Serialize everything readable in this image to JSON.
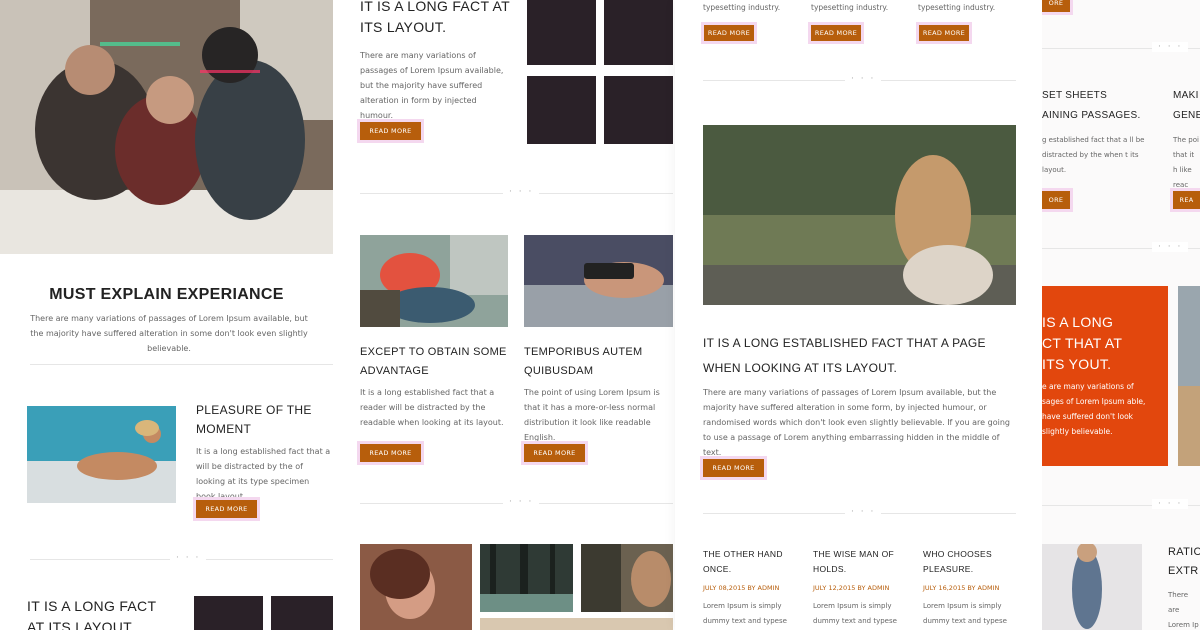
{
  "panel1": {
    "section_title": "MUST EXPLAIN EXPERIANCE",
    "section_text": "There are many variations of passages of Lorem Ipsum available, but the majority have suffered alteration in some don't look even slightly believable.",
    "feature_title": "PLEASURE OF THE MOMENT",
    "feature_text": "It is a long established fact that a will be distracted by the of looking at its type specimen book layout.",
    "feature_btn": "READ MORE",
    "bottom_title": "IT IS A LONG FACT AT ITS LAYOUT.",
    "dots": "· · ·"
  },
  "panel2": {
    "top_title": "IT IS A LONG FACT AT ITS LAYOUT.",
    "top_text": "There are many variations of passages of Lorem Ipsum available, but the majority have suffered alteration in form by injected humour.",
    "top_btn": "READ MORE",
    "dots": "· · ·",
    "card1_title": "EXCEPT TO OBTAIN SOME ADVANTAGE",
    "card1_text": "It is a long established fact that a reader will be distracted by the readable when looking at its layout.",
    "card1_btn": "READ MORE",
    "card2_title": "TEMPORIBUS AUTEM QUIBUSDAM",
    "card2_text": "The point of using Lorem Ipsum is that it has a more-or-less normal distribution it look like readable English.",
    "card2_btn": "READ MORE"
  },
  "panel3": {
    "col1_text": "typesetting industry.",
    "col2_text": "typesetting industry.",
    "col3_text": "typesetting industry.",
    "btn": "READ MORE",
    "dots": "· · ·",
    "main_title": "IT IS A LONG ESTABLISHED FACT THAT A PAGE WHEN LOOKING AT ITS LAYOUT.",
    "main_text": "There are many variations of passages of Lorem Ipsum available, but the majority have suffered alteration in some form, by injected humour, or randomised words which don't look even slightly believable. If you are going to use a passage of Lorem anything embarrassing hidden in the middle of text.",
    "main_btn": "READ MORE",
    "posts": [
      {
        "title": "THE OTHER HAND ONCE.",
        "date": "JULY 08,2015 BY ADMIN",
        "text": "Lorem Ipsum is simply dummy text and typese"
      },
      {
        "title": "THE WISE MAN OF HOLDS.",
        "date": "JULY 12,2015 BY ADMIN",
        "text": "Lorem Ipsum is simply dummy text and typese"
      },
      {
        "title": "WHO CHOOSES PLEASURE.",
        "date": "JULY 16,2015 BY ADMIN",
        "text": "Lorem Ipsum is simply dummy text and typese"
      }
    ]
  },
  "panel4": {
    "title1a": "SET SHEETS",
    "title1b": "AINING PASSAGES.",
    "text1": "g established fact that a ll be distracted by the when t its layout.",
    "btn1": "ORE",
    "title2a": "MAKI",
    "title2b": "GENE",
    "text2": "The poi that it h like reac",
    "btn2": "REA",
    "top_btn": "ORE",
    "dots": "· · ·",
    "orange_title": "IS A LONG CT THAT AT ITS YOUT.",
    "orange_text": "e are many variations of sages of Lorem Ipsum able, have suffered don't look slightly believable.",
    "bottom_title_a": "RATIC",
    "bottom_title_b": "EXTR",
    "bottom_text": "There are Lorem Ip"
  },
  "colors": {
    "accent": "#b75e0c",
    "orange_block": "#e2470d",
    "dark": "#2a2128"
  }
}
